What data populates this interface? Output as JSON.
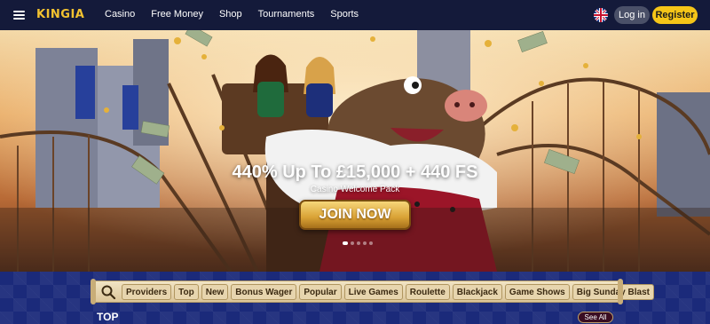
{
  "header": {
    "logo": "KINGIA",
    "nav": [
      "Casino",
      "Free Money",
      "Shop",
      "Tournaments",
      "Sports"
    ],
    "login_label": "Log in",
    "register_label": "Register",
    "language_flag": "uk-flag-icon"
  },
  "hero": {
    "title": "440% Up To £15,000 + 440 FS",
    "subtitle": "Casino Welcome Pack",
    "cta": "JOIN NOW",
    "slides_count": 5,
    "active_slide": 1
  },
  "filter_bar": {
    "search_icon": "search-icon",
    "chips": [
      "Providers",
      "Top",
      "New",
      "Bonus Wager",
      "Popular",
      "Live Games",
      "Roulette",
      "Blackjack",
      "Game Shows",
      "Big Sunday Blast"
    ]
  },
  "section": {
    "title": "TOP",
    "see_all": "See All"
  },
  "colors": {
    "header_bg": "#141a3a",
    "accent_yellow": "#f5c518",
    "lower_bg": "#1b2a7a",
    "join_gold": "#d9a235"
  }
}
